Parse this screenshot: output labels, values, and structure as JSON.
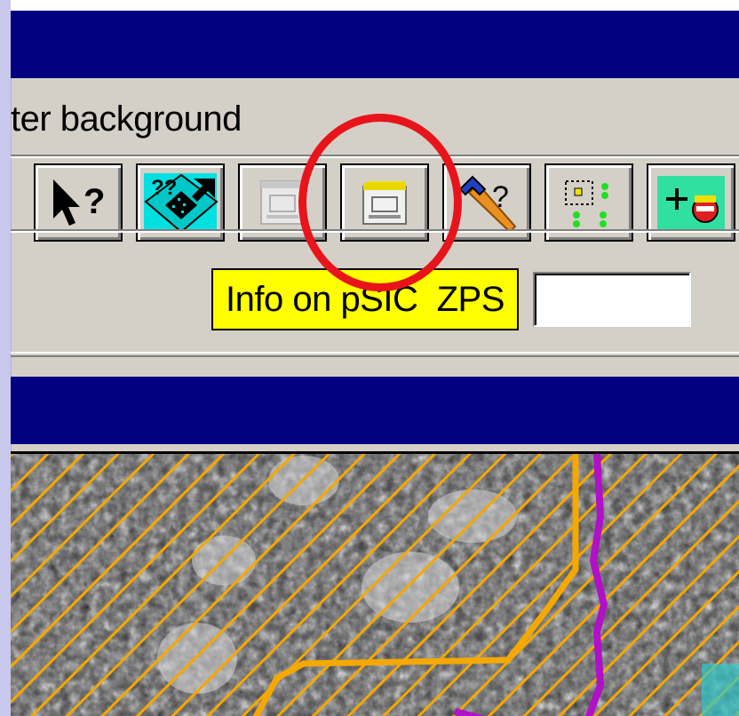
{
  "window": {
    "label": "ter background"
  },
  "toolbar": {
    "buttons": [
      {
        "id": "whats-this",
        "icon": "cursor-question-icon"
      },
      {
        "id": "layer-info",
        "icon": "diamond-info-icon"
      },
      {
        "id": "form-disabled",
        "icon": "form-grey-icon"
      },
      {
        "id": "info-psic-zps",
        "icon": "form-yellow-icon"
      },
      {
        "id": "hammer-query",
        "icon": "hammer-question-icon"
      },
      {
        "id": "select-points",
        "icon": "dots-select-icon"
      },
      {
        "id": "zoom-plus-minus",
        "icon": "plus-minus-icon"
      }
    ]
  },
  "tooltip": {
    "text": "Info on pSIC  ZPS"
  },
  "colors": {
    "titlebar": "#000080",
    "tooltip_bg": "#ffff00",
    "highlight": "#e8141b",
    "map_hatch": "#f5a800",
    "map_road": "#f5a800",
    "map_boundary": "#b010c8"
  }
}
